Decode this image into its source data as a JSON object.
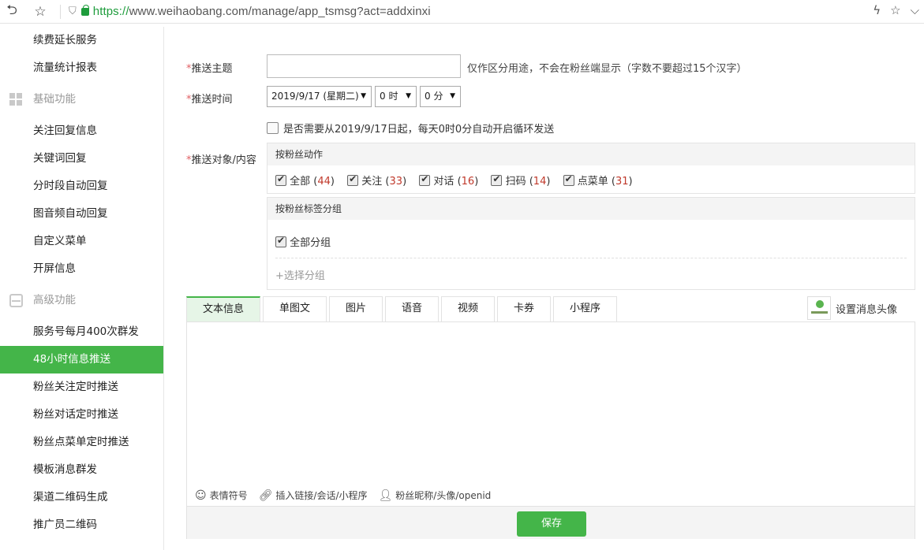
{
  "browser": {
    "url_scheme": "https://",
    "url_rest": "www.weihaobang.com/manage/app_tsmsg?act=addxinxi"
  },
  "sidebar": {
    "top_items": [
      "续费延长服务",
      "流量统计报表"
    ],
    "group_basic": "基础功能",
    "basic_items": [
      "关注回复信息",
      "关键词回复",
      "分时段自动回复",
      "图音频自动回复",
      "自定义菜单",
      "开屏信息"
    ],
    "group_advanced": "高级功能",
    "advanced_items": [
      "服务号每月400次群发",
      "48小时信息推送",
      "粉丝关注定时推送",
      "粉丝对话定时推送",
      "粉丝点菜单定时推送",
      "模板消息群发",
      "渠道二维码生成",
      "推广员二维码"
    ],
    "active_item": "48小时信息推送"
  },
  "form": {
    "topic_label": "推送主题",
    "topic_value": "",
    "topic_hint": "仅作区分用途，不会在粉丝端显示（字数不要超过15个汉字）",
    "time_label": "推送时间",
    "date_value": "2019/9/17 (星期二)",
    "hour_value": "0 时",
    "minute_value": "0 分",
    "loop_label": "是否需要从2019/9/17日起，每天0时0分自动开启循环发送",
    "target_label": "推送对象/内容",
    "action_header": "按粉丝动作",
    "actions": [
      {
        "label": "全部",
        "count": "44"
      },
      {
        "label": "关注",
        "count": "33"
      },
      {
        "label": "对话",
        "count": "16"
      },
      {
        "label": "扫码",
        "count": "14"
      },
      {
        "label": "点菜单",
        "count": "31"
      }
    ],
    "tag_header": "按粉丝标签分组",
    "all_group_label": "全部分组",
    "add_group_label": "+选择分组"
  },
  "tabs": [
    "文本信息",
    "单图文",
    "图片",
    "语音",
    "视频",
    "卡券",
    "小程序"
  ],
  "avatar_label": "设置消息头像",
  "toolbar": {
    "emoji": "表情符号",
    "link": "插入链接/会话/小程序",
    "fan": "粉丝昵称/头像/openid"
  },
  "save_label": "保存",
  "colors": {
    "accent": "#44b549",
    "required": "#e15f63",
    "count": "#c0392b"
  }
}
